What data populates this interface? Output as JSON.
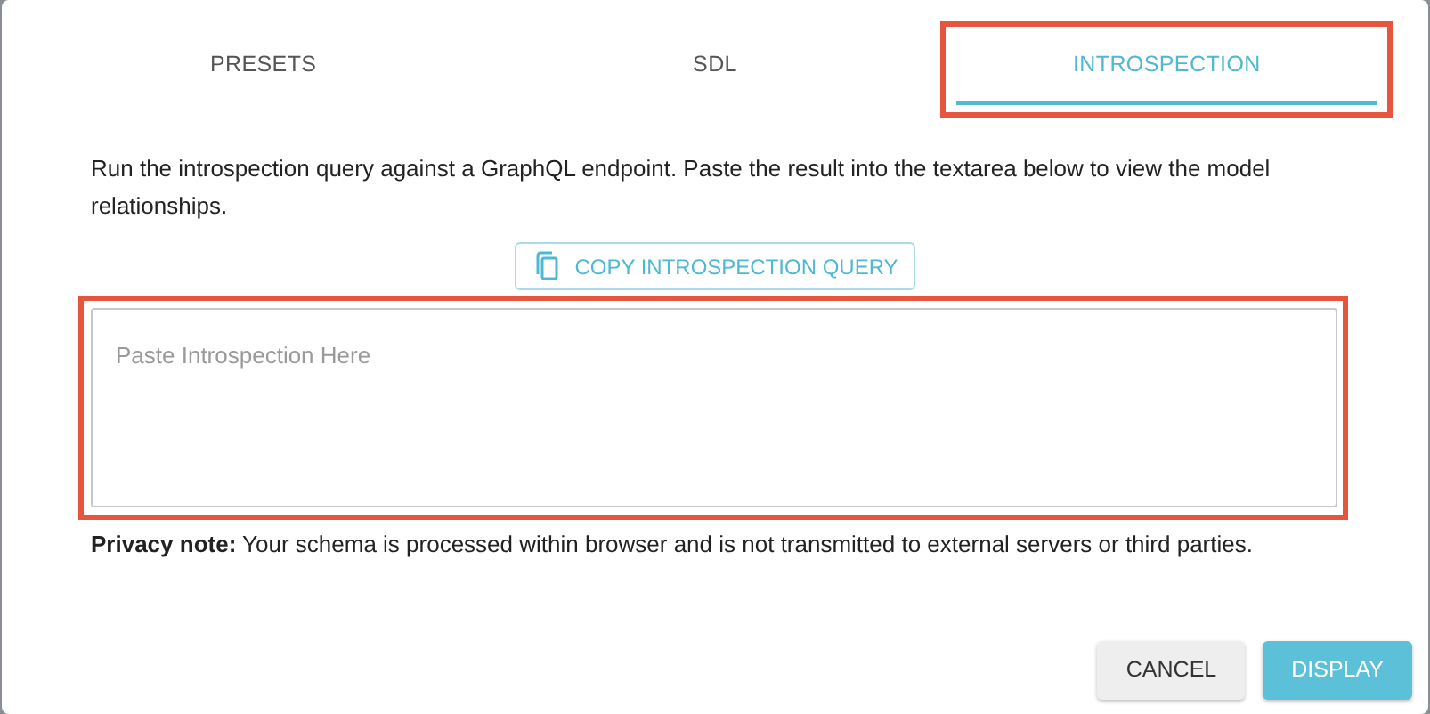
{
  "tabs": [
    {
      "label": "PRESETS",
      "selected": false,
      "highlighted": false
    },
    {
      "label": "SDL",
      "selected": false,
      "highlighted": false
    },
    {
      "label": "INTROSPECTION",
      "selected": true,
      "highlighted": true
    }
  ],
  "instructions": "Run the introspection query against a GraphQL endpoint. Paste the result into the textarea below to view the model relationships.",
  "copy_button": {
    "label": "COPY INTROSPECTION QUERY"
  },
  "introspection_field": {
    "placeholder": "Paste Introspection Here",
    "highlighted": true
  },
  "privacy_note": "**Privacy note:** Your schema is processed within browser and is not transmitted to external servers or third parties.",
  "buttons": [
    {
      "label": "CANCEL",
      "kind": "secondary"
    },
    {
      "label": "DISPLAY",
      "kind": "primary"
    }
  ]
}
